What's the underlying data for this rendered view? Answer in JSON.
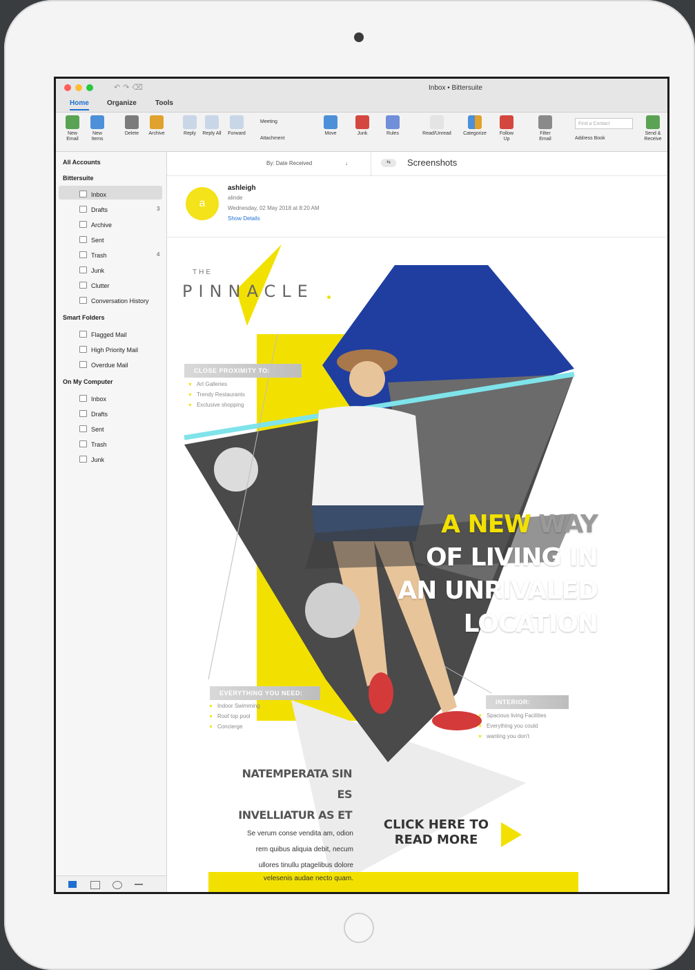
{
  "window": {
    "title": "Inbox • Bittersuite"
  },
  "tabs": [
    {
      "label": "Home"
    },
    {
      "label": "Organize"
    },
    {
      "label": "Tools"
    }
  ],
  "ribbon": {
    "new_email": "New Email",
    "new_items": "New Items",
    "delete": "Delete",
    "archive": "Archive",
    "reply": "Reply",
    "reply_all": "Reply All",
    "forward": "Forward",
    "meeting": "Meeting",
    "attachment": "Attachment",
    "move": "Move",
    "junk": "Junk",
    "rules": "Rules",
    "read_unread": "Read/Unread",
    "categorize": "Categorize",
    "follow_up": "Follow Up",
    "filter_email": "Filter Email",
    "find_contact_placeholder": "Find a Contact",
    "address_book": "Address Book",
    "send_receive": "Send & Receive"
  },
  "sidebar": {
    "all_accounts": "All Accounts",
    "account": "Bittersuite",
    "account_folders": [
      {
        "label": "Inbox",
        "count": ""
      },
      {
        "label": "Drafts",
        "count": "3"
      },
      {
        "label": "Archive",
        "count": ""
      },
      {
        "label": "Sent",
        "count": ""
      },
      {
        "label": "Trash",
        "count": "4"
      },
      {
        "label": "Junk",
        "count": ""
      },
      {
        "label": "Clutter",
        "count": ""
      },
      {
        "label": "Conversation History",
        "count": ""
      }
    ],
    "smart_folders": "Smart Folders",
    "smart_items": [
      {
        "label": "Flagged Mail"
      },
      {
        "label": "High Priority Mail"
      },
      {
        "label": "Overdue Mail"
      }
    ],
    "on_my_computer": "On My Computer",
    "local_folders": [
      {
        "label": "Inbox"
      },
      {
        "label": "Drafts"
      },
      {
        "label": "Sent"
      },
      {
        "label": "Trash"
      },
      {
        "label": "Junk"
      }
    ]
  },
  "message_list": {
    "sort_label": "By: Date Received",
    "sort_arrow": "↓"
  },
  "conversation": {
    "folder_chip": "⇆",
    "title": "Screenshots"
  },
  "message": {
    "avatar_initial": "a",
    "sender": "ashleigh",
    "sender_sub": "alinde",
    "date": "Wednesday, 02 May 2018 at 8:20 AM",
    "show_details": "Show Details"
  },
  "flyer": {
    "brand_the": "THE",
    "brand": "PINNACLE",
    "headline_l1_a": "A NEW",
    "headline_l1_b": " WAY",
    "headline_l2": "OF LIVING IN",
    "headline_l3": "AN UNRIVALED",
    "headline_l4": "LOCATION",
    "section1": "CLOSE PROXIMITY TO:",
    "section1_items": [
      "Art Galleries",
      "Trendy Restaurants",
      "Exclusive shopping"
    ],
    "section2": "EVERYTHING YOU NEED:",
    "section2_items": [
      "Indoor Swimming",
      "Roof top pool",
      "Concierge"
    ],
    "section3": "INTERIOR:",
    "section3_items": [
      "Spacious living Facilities",
      "Everything you could",
      "wanting you don't"
    ],
    "sub_head_l1": "NATEMPERATA SIN ES",
    "sub_head_l2": "INVELLIATUR AS ET",
    "body_l1": "Se verum conse vendita am, odion",
    "body_l2": "rem quibus aliquia debit, necum",
    "body_l3": "ullores tinullu ptagelibus dolore",
    "body_l4": "velesenis audae necto quam.",
    "cta_l1": "CLICK HERE TO",
    "cta_l2": "READ MORE",
    "accent_color": "#f2e100",
    "sky_color": "#1f3ea0",
    "cyan_line_color": "#7fe3ea"
  }
}
